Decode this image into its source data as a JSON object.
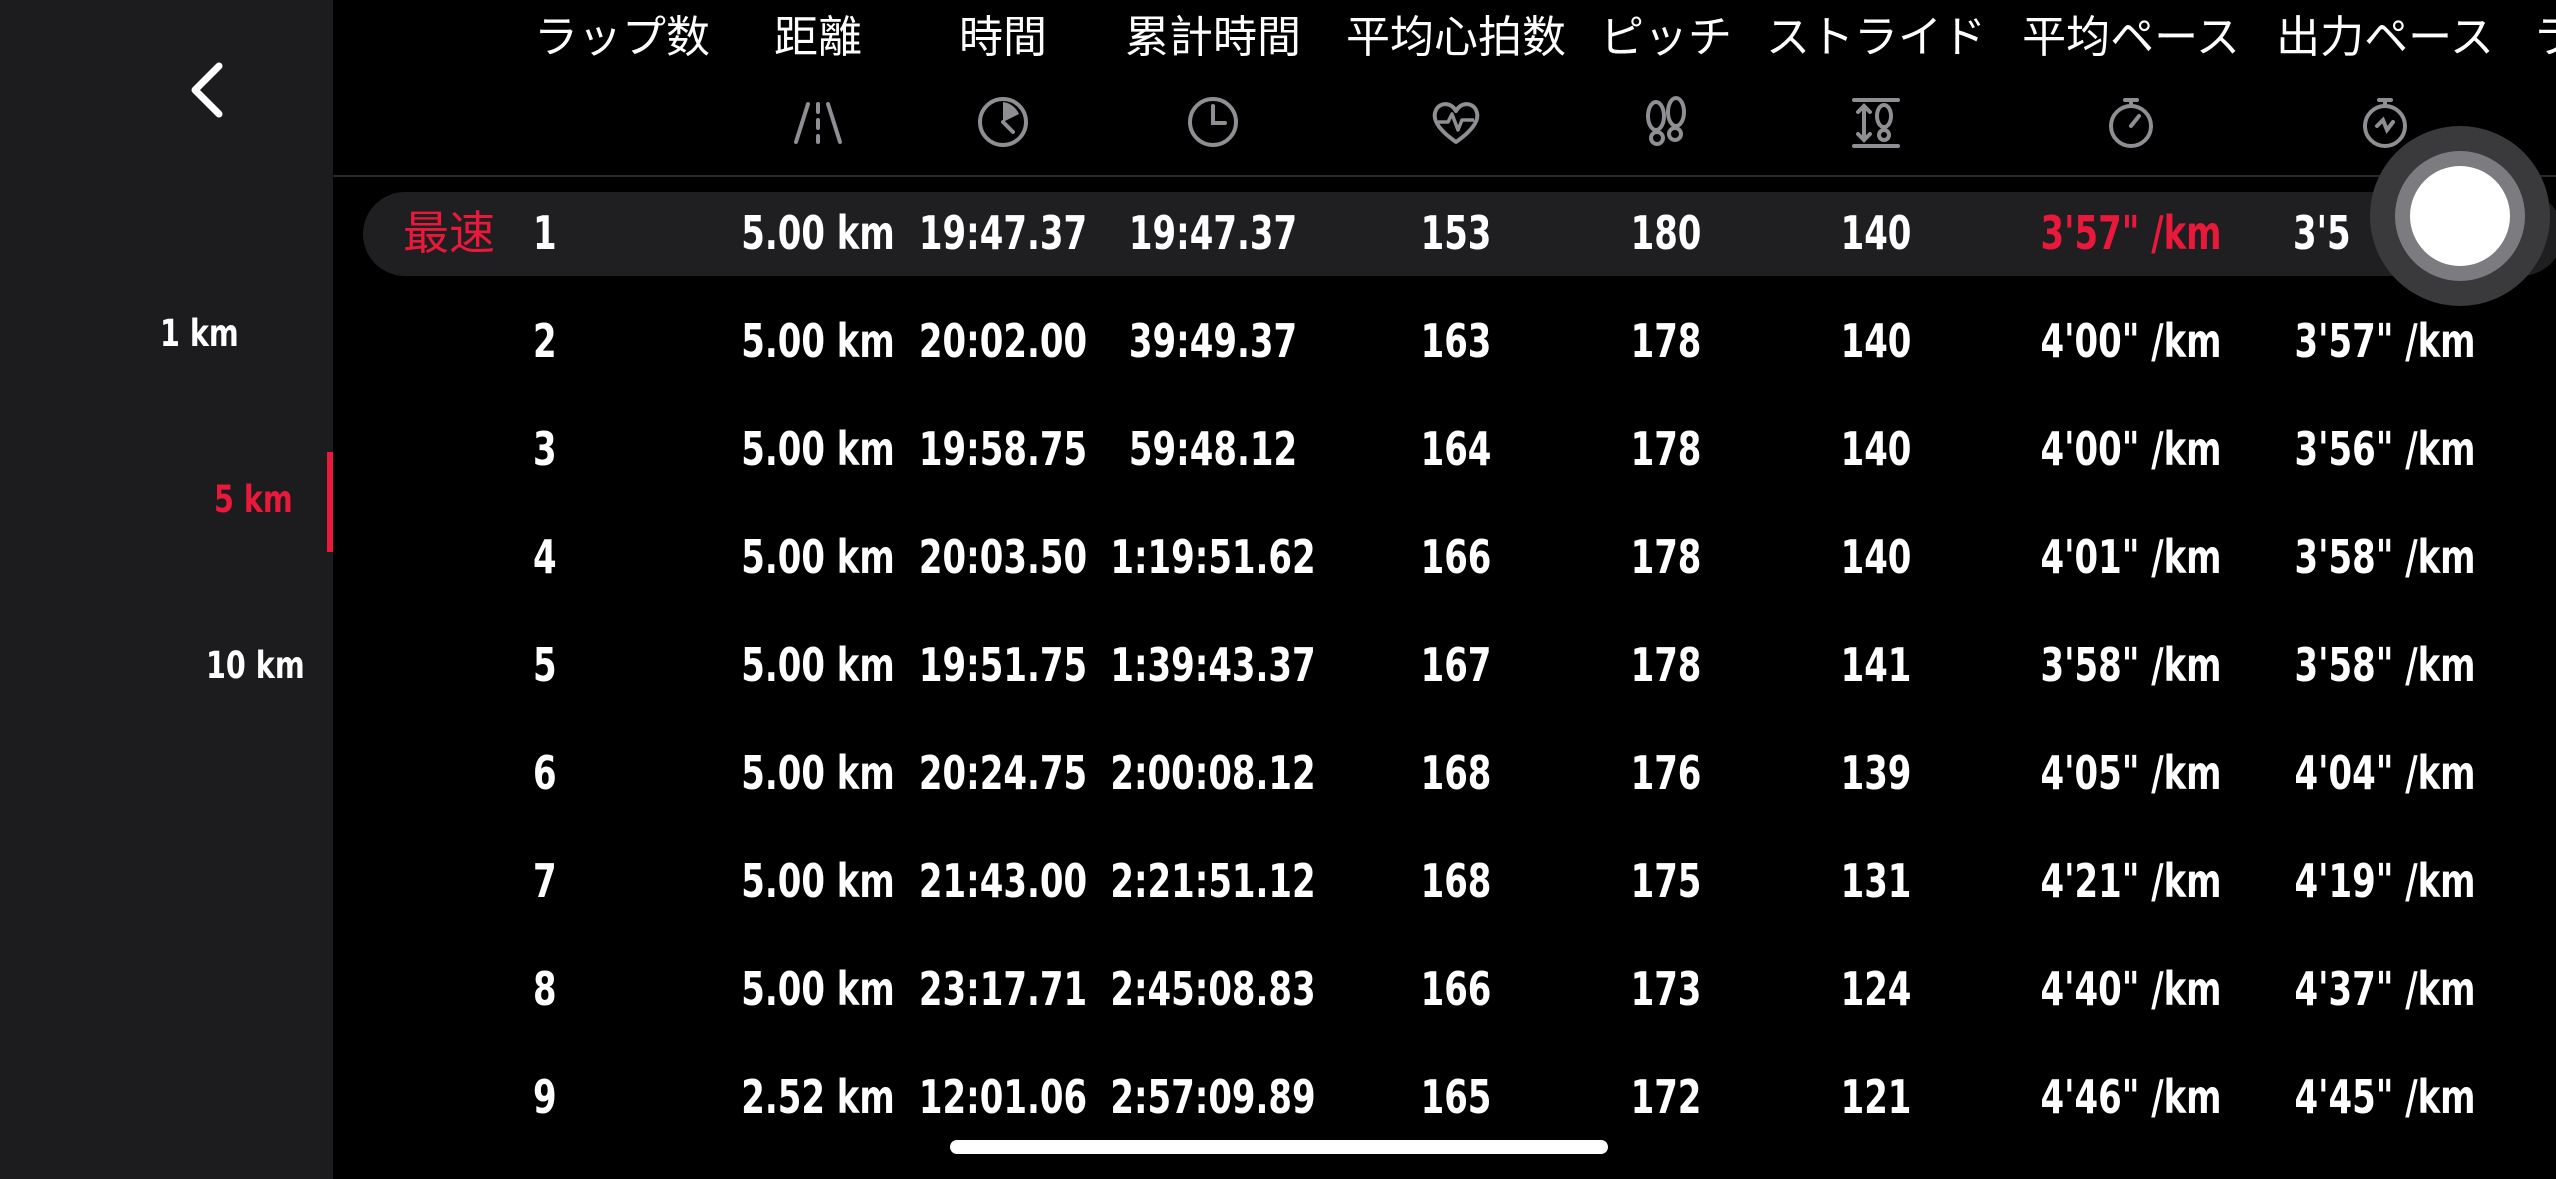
{
  "nav": {
    "back_icon": "chevron-left-icon"
  },
  "split_options": [
    {
      "label": "1 km",
      "active": false
    },
    {
      "label": "5 km",
      "active": true
    },
    {
      "label": "10 km",
      "active": false
    }
  ],
  "columns": [
    {
      "label": "ラップ数",
      "icon": ""
    },
    {
      "label": "距離",
      "icon": "road-distance-icon"
    },
    {
      "label": "時間",
      "icon": "lap-time-clock-icon"
    },
    {
      "label": "累計時間",
      "icon": "cumulative-time-clock-icon"
    },
    {
      "label": "平均心拍数",
      "icon": "heart-rate-icon"
    },
    {
      "label": "ピッチ",
      "icon": "footprints-icon"
    },
    {
      "label": "ストライド",
      "icon": "stride-length-icon"
    },
    {
      "label": "平均ペース",
      "icon": "stopwatch-icon"
    },
    {
      "label": "出力ペース",
      "icon": "power-pace-stopwatch-icon"
    },
    {
      "label": "ラ",
      "icon": ""
    }
  ],
  "fastest_label": "最速",
  "rows": [
    {
      "lap": "1",
      "distance": "5.00 km",
      "time": "19:47.37",
      "cumulative": "19:47.37",
      "hr": "153",
      "pitch": "180",
      "stride": "140",
      "avg_pace": "3'57\" /km",
      "power_pace": "3'5",
      "fastest": true
    },
    {
      "lap": "2",
      "distance": "5.00 km",
      "time": "20:02.00",
      "cumulative": "39:49.37",
      "hr": "163",
      "pitch": "178",
      "stride": "140",
      "avg_pace": "4'00\" /km",
      "power_pace": "3'57\" /km",
      "fastest": false
    },
    {
      "lap": "3",
      "distance": "5.00 km",
      "time": "19:58.75",
      "cumulative": "59:48.12",
      "hr": "164",
      "pitch": "178",
      "stride": "140",
      "avg_pace": "4'00\" /km",
      "power_pace": "3'56\" /km",
      "fastest": false
    },
    {
      "lap": "4",
      "distance": "5.00 km",
      "time": "20:03.50",
      "cumulative": "1:19:51.62",
      "hr": "166",
      "pitch": "178",
      "stride": "140",
      "avg_pace": "4'01\" /km",
      "power_pace": "3'58\" /km",
      "fastest": false
    },
    {
      "lap": "5",
      "distance": "5.00 km",
      "time": "19:51.75",
      "cumulative": "1:39:43.37",
      "hr": "167",
      "pitch": "178",
      "stride": "141",
      "avg_pace": "3'58\" /km",
      "power_pace": "3'58\" /km",
      "fastest": false
    },
    {
      "lap": "6",
      "distance": "5.00 km",
      "time": "20:24.75",
      "cumulative": "2:00:08.12",
      "hr": "168",
      "pitch": "176",
      "stride": "139",
      "avg_pace": "4'05\" /km",
      "power_pace": "4'04\" /km",
      "fastest": false
    },
    {
      "lap": "7",
      "distance": "5.00 km",
      "time": "21:43.00",
      "cumulative": "2:21:51.12",
      "hr": "168",
      "pitch": "175",
      "stride": "131",
      "avg_pace": "4'21\" /km",
      "power_pace": "4'19\" /km",
      "fastest": false
    },
    {
      "lap": "8",
      "distance": "5.00 km",
      "time": "23:17.71",
      "cumulative": "2:45:08.83",
      "hr": "166",
      "pitch": "173",
      "stride": "124",
      "avg_pace": "4'40\" /km",
      "power_pace": "4'37\" /km",
      "fastest": false
    },
    {
      "lap": "9",
      "distance": "2.52 km",
      "time": "12:01.06",
      "cumulative": "2:57:09.89",
      "hr": "165",
      "pitch": "172",
      "stride": "121",
      "avg_pace": "4'46\" /km",
      "power_pace": "4'45\" /km",
      "fastest": false
    }
  ],
  "colors": {
    "accent": "#e8193a",
    "sidebar_bg": "#1c1c1e",
    "background": "#000000",
    "text": "#ffffff"
  },
  "floating_button": {
    "icon": "assistive-touch-icon"
  }
}
